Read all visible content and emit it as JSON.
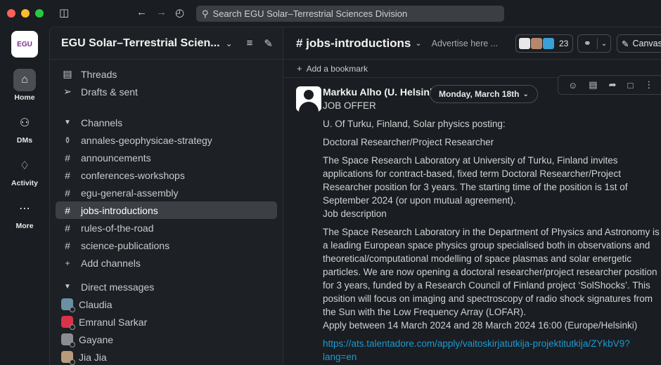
{
  "search": {
    "placeholder": "Search EGU Solar–Terrestrial Sciences Division"
  },
  "workspace": {
    "logo": "EGU",
    "name": "EGU Solar–Terrestrial Scien...",
    "more": "ᴏ"
  },
  "rail": [
    {
      "label": "Home",
      "icon": "home-icon"
    },
    {
      "label": "DMs",
      "icon": "dms-icon"
    },
    {
      "label": "Activity",
      "icon": "bell-icon"
    },
    {
      "label": "More",
      "icon": "more-icon"
    }
  ],
  "sidebar": {
    "threads": "Threads",
    "drafts": "Drafts & sent",
    "channels_header": "Channels",
    "channels": [
      {
        "name": "annales-geophysicae-strategy",
        "icon": "lock-icon",
        "glyph": "🔒"
      },
      {
        "name": "announcements",
        "icon": "hash-icon",
        "glyph": "#"
      },
      {
        "name": "conferences-workshops",
        "icon": "hash-icon",
        "glyph": "#"
      },
      {
        "name": "egu-general-assembly",
        "icon": "hash-icon",
        "glyph": "#"
      },
      {
        "name": "jobs-introductions",
        "icon": "hash-icon",
        "glyph": "#",
        "active": true
      },
      {
        "name": "rules-of-the-road",
        "icon": "hash-icon",
        "glyph": "#"
      },
      {
        "name": "science-publications",
        "icon": "hash-icon",
        "glyph": "#"
      }
    ],
    "add_channels": "Add channels",
    "dm_header": "Direct messages",
    "dms": [
      {
        "name": "Claudia",
        "color": "#6b8fa3"
      },
      {
        "name": "Emranul Sarkar",
        "color": "#d9334a"
      },
      {
        "name": "Gayane",
        "color": "#8a8d91"
      },
      {
        "name": "Jia Jia",
        "color": "#b89a7a"
      }
    ]
  },
  "channel": {
    "name": "# jobs-introductions",
    "topic": "Advertise here ...",
    "member_count": "23",
    "canvas": "Canvas",
    "bookmark": "Add a bookmark"
  },
  "message": {
    "author": "Markku Alho (U. Helsinki)",
    "date": "Monday, March 18th",
    "lines": [
      "JOB OFFER",
      "U. Of Turku, Finland, Solar physics posting:",
      "Doctoral Researcher/Project Researcher",
      "The Space Research Laboratory at University of Turku, Finland invites applications for contract-based, fixed term Doctoral Researcher/Project Researcher position for 3 years. The starting time of the position is 1st of September 2024 (or upon mutual agreement).",
      "Job description",
      "The Space Research Laboratory in the Department of Physics and Astronomy is a leading European space physics group specialised both in observations and theoretical/computational modelling of space plasmas and solar energetic particles. We are now opening a doctoral researcher/project researcher position for 3 years, funded by a Research Council of Finland project ‘SolShocks’. This position will focus on imaging and spectroscopy of radio shock signatures from the Sun with the Low Frequency Array (LOFAR).",
      "Apply between 14 March 2024 and 28 March 2024 16:00 (Europe/Helsinki)",
      "https://ats.talentadore.com/apply/vaitoskirjatutkija-projektitutkija/ZYkbV9?lang=en"
    ]
  }
}
